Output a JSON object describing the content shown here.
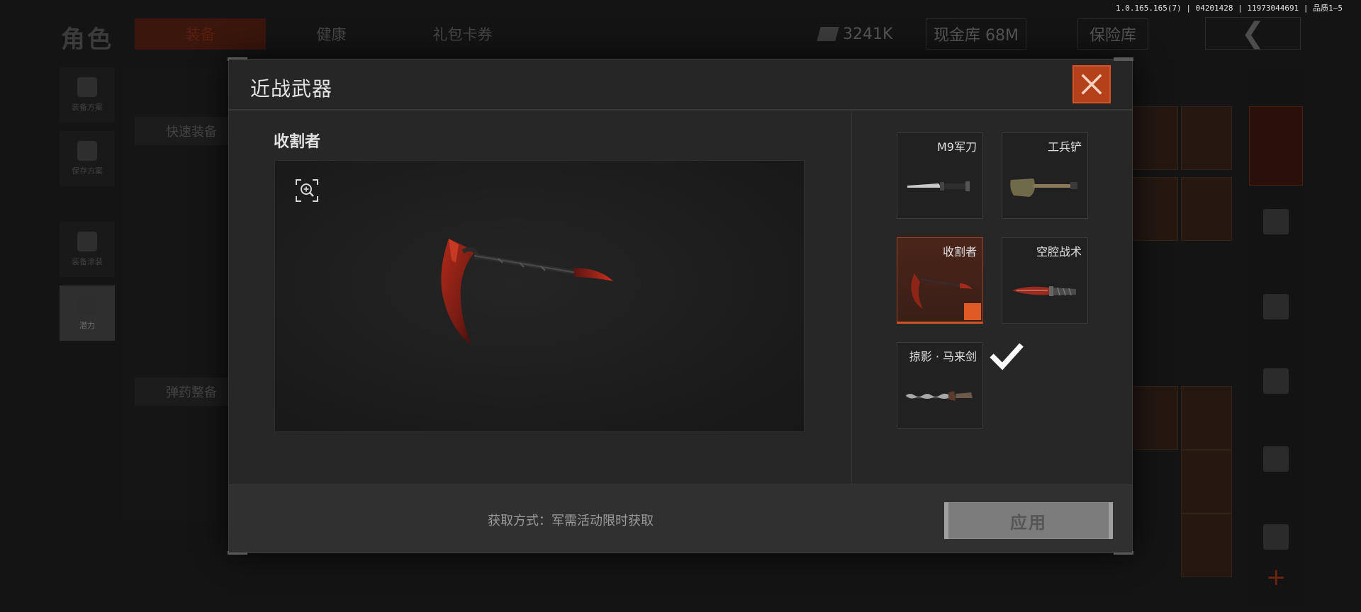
{
  "version_info": "1.0.165.165(7) | 04201428 | 11973044691 | 品质1~5",
  "background": {
    "title": "角色",
    "tabs": [
      "装备",
      "健康",
      "礼包卡券"
    ],
    "resources": {
      "cash": "3241K",
      "cash_vault": "现金库 68M",
      "safe_box": "保险库"
    },
    "sidebar": [
      "装备方案",
      "保存方案",
      "装备涂装",
      "潜力"
    ],
    "quick_equip": "快速装备",
    "ammo_setup": "弹药整备"
  },
  "modal": {
    "title": "近战武器",
    "preview": {
      "name": "收割者"
    },
    "weapons": [
      {
        "name": "M9军刀",
        "icon": "bayonet-icon",
        "selected": false
      },
      {
        "name": "工兵铲",
        "icon": "shovel-icon",
        "selected": false
      },
      {
        "name": "收割者",
        "icon": "scythe-icon",
        "selected": true
      },
      {
        "name": "空腔战术",
        "icon": "tactical-knife-icon",
        "selected": false
      },
      {
        "name": "掠影 · 马来剑",
        "icon": "kris-sword-icon",
        "selected": false
      }
    ],
    "acquire_text": "获取方式：军需活动限时获取",
    "apply_label": "应用",
    "colors": {
      "accent": "#d2532a",
      "close": "#b5411b"
    }
  }
}
